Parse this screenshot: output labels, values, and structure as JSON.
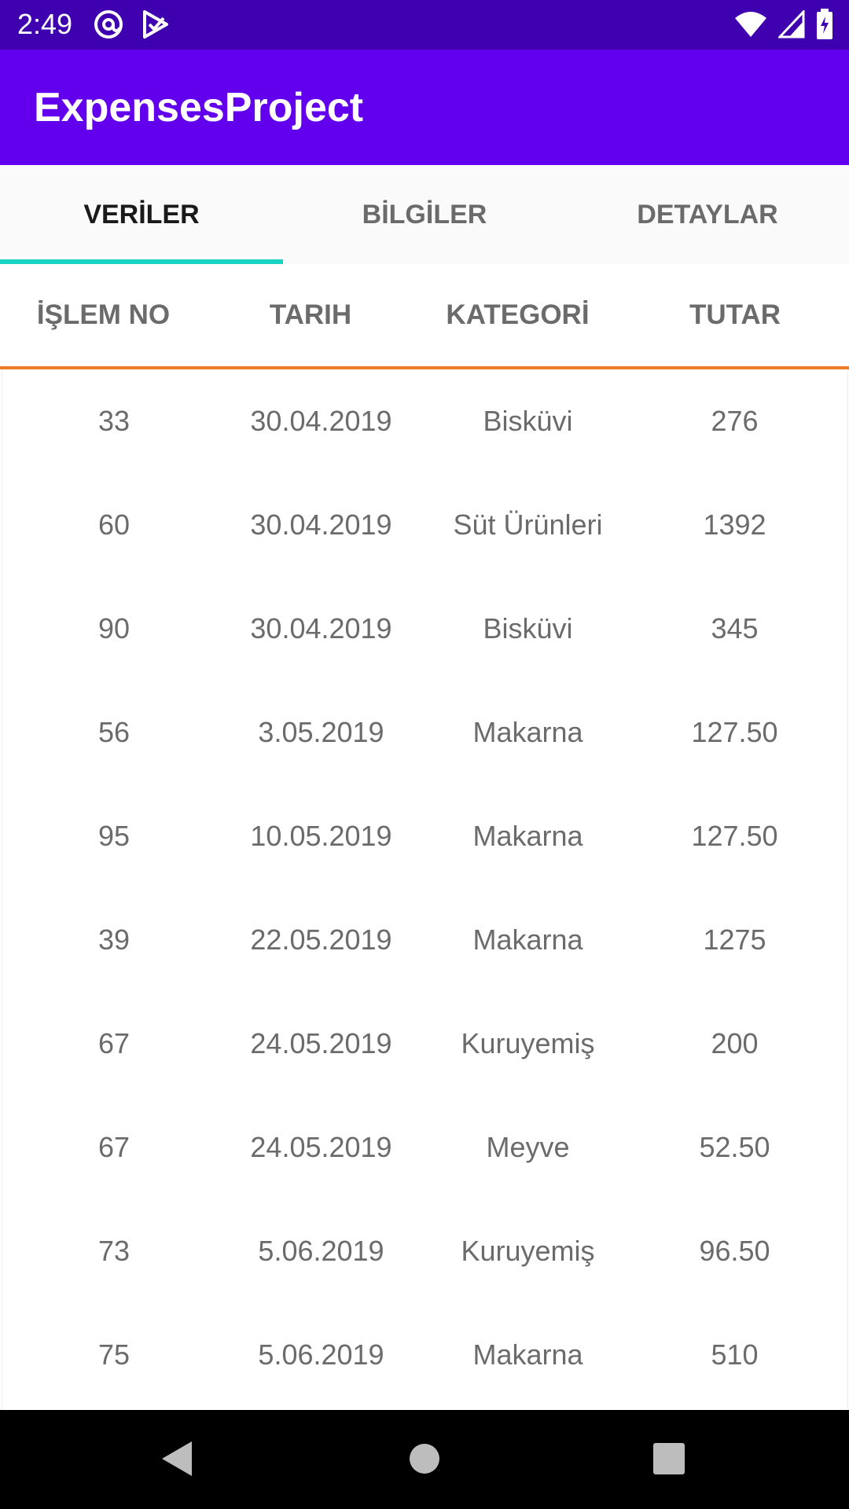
{
  "status_bar": {
    "time": "2:49",
    "icons_left": [
      "at-sign-icon",
      "play-store-icon"
    ],
    "icons_right": [
      "wifi-icon",
      "cell-signal-icon",
      "battery-icon"
    ]
  },
  "app_bar": {
    "title": "ExpensesProject",
    "color": "#6200ee"
  },
  "tabs": [
    {
      "label": "VERİLER",
      "active": true
    },
    {
      "label": "BİLGİLER",
      "active": false
    },
    {
      "label": "DETAYLAR",
      "active": false
    }
  ],
  "table": {
    "columns": [
      "İŞLEM NO",
      "TARIH",
      "KATEGORİ",
      "TUTAR"
    ],
    "rows": [
      [
        "33",
        "30.04.2019",
        "Bisküvi",
        "276"
      ],
      [
        "60",
        "30.04.2019",
        "Süt Ürünleri",
        "1392"
      ],
      [
        "90",
        "30.04.2019",
        "Bisküvi",
        "345"
      ],
      [
        "56",
        "3.05.2019",
        "Makarna",
        "127.50"
      ],
      [
        "95",
        "10.05.2019",
        "Makarna",
        "127.50"
      ],
      [
        "39",
        "22.05.2019",
        "Makarna",
        "1275"
      ],
      [
        "67",
        "24.05.2019",
        "Kuruyemiş",
        "200"
      ],
      [
        "67",
        "24.05.2019",
        "Meyve",
        "52.50"
      ],
      [
        "73",
        "5.06.2019",
        "Kuruyemiş",
        "96.50"
      ],
      [
        "75",
        "5.06.2019",
        "Makarna",
        "510"
      ]
    ]
  },
  "colors": {
    "tab_indicator": "#1bd3c2",
    "header_divider": "#ee7b27",
    "status_bar": "#3f00b0"
  },
  "nav_bar": {
    "buttons": [
      "back-icon",
      "home-icon",
      "recents-icon"
    ]
  }
}
